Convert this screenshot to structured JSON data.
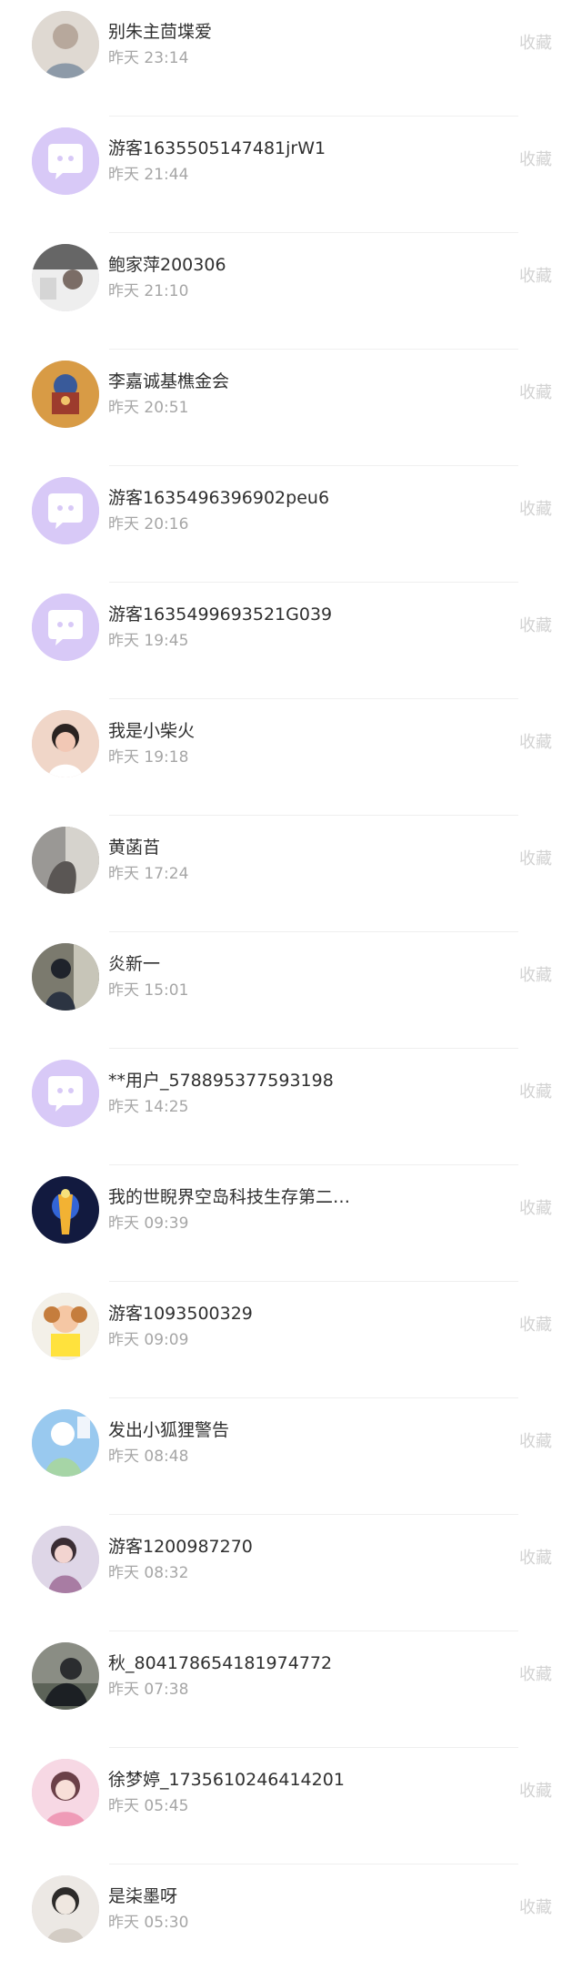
{
  "collect_label": "收藏",
  "colors": {
    "guest_avatar_bg": "#d8c9f7",
    "guest_avatar_icon": "#ffffff",
    "name_text": "#2f2f2f",
    "time_text": "#a6a6a6",
    "collect_text": "#d2d2d2"
  },
  "rows": [
    {
      "name": "别朱主茴堞爱",
      "time": "昨天 23:14",
      "avatar": "photo-avatar"
    },
    {
      "name": "游客1635505147481jrW1",
      "time": "昨天 21:44",
      "avatar": "guest-avatar"
    },
    {
      "name": "鲍家萍200306",
      "time": "昨天 21:10",
      "avatar": "photo-avatar"
    },
    {
      "name": "李嘉诚基樵金会",
      "time": "昨天 20:51",
      "avatar": "photo-avatar"
    },
    {
      "name": "游客1635496396902peu6",
      "time": "昨天 20:16",
      "avatar": "guest-avatar"
    },
    {
      "name": "游客1635499693521G039",
      "time": "昨天 19:45",
      "avatar": "guest-avatar"
    },
    {
      "name": "我是小柴火",
      "time": "昨天 19:18",
      "avatar": "photo-avatar"
    },
    {
      "name": "黄菡苩",
      "time": "昨天 17:24",
      "avatar": "photo-avatar"
    },
    {
      "name": "炎新一",
      "time": "昨天 15:01",
      "avatar": "photo-avatar"
    },
    {
      "name": "**用户_578895377593198",
      "time": "昨天 14:25",
      "avatar": "guest-avatar"
    },
    {
      "name": "我的世睨界空岛科技生存第二…",
      "time": "昨天 09:39",
      "avatar": "photo-avatar"
    },
    {
      "name": "游客1093500329",
      "time": "昨天 09:09",
      "avatar": "photo-avatar"
    },
    {
      "name": "发出小狐狸警告",
      "time": "昨天 08:48",
      "avatar": "photo-avatar"
    },
    {
      "name": "游客1200987270",
      "time": "昨天 08:32",
      "avatar": "photo-avatar"
    },
    {
      "name": "秋_804178654181974772",
      "time": "昨天 07:38",
      "avatar": "photo-avatar"
    },
    {
      "name": "徐梦婷_1735610246414201",
      "time": "昨天 05:45",
      "avatar": "photo-avatar"
    },
    {
      "name": "是柒墨呀",
      "time": "昨天 05:30",
      "avatar": "photo-avatar"
    }
  ]
}
